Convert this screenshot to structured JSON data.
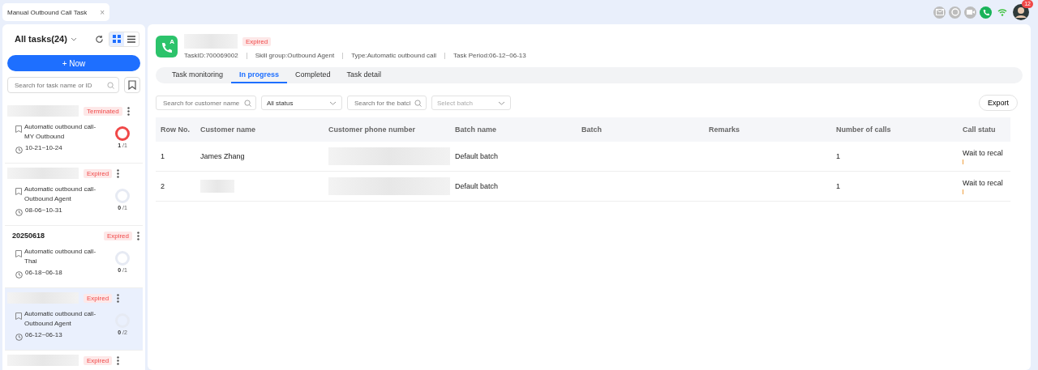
{
  "app_tab": {
    "title": "Manual Outbound Call Task",
    "close": "×"
  },
  "header_icons": [
    {
      "kind": "mail"
    },
    {
      "kind": "chat"
    },
    {
      "kind": "video"
    },
    {
      "kind": "phone"
    },
    {
      "kind": "wifi"
    },
    {
      "kind": "avatar",
      "badge": "12"
    }
  ],
  "sidebar": {
    "title": "All tasks(24)",
    "new_button": "+ Now",
    "search_placeholder": "Search for task name or ID",
    "tasks": [
      {
        "status": "Terminated",
        "type": "Automatic outbound call-MY Outbound",
        "period": "10-21~10-24",
        "count": "1",
        "total": "/1",
        "complete": true,
        "selected": false
      },
      {
        "status": "Expired",
        "type": "Automatic outbound call-Outbound Agent",
        "period": "08-06~10-31",
        "count": "0",
        "total": "/1",
        "complete": false,
        "selected": false
      },
      {
        "name": "20250618",
        "status": "Expired",
        "type": "Automatic outbound call-Thai",
        "period": "06-18~06-18",
        "count": "0",
        "total": "/1",
        "complete": false,
        "selected": false
      },
      {
        "status": "Expired",
        "type": "Automatic outbound call-Outbound Agent",
        "period": "06-12~06-13",
        "count": "0",
        "total": "/2",
        "complete": false,
        "selected": true
      },
      {
        "status": "Expired",
        "selected": false
      }
    ]
  },
  "task": {
    "logo_letter": "A",
    "status": "Expired",
    "meta": [
      "TaskID:700069002",
      "Skill group:Outbound Agent",
      "Type:Automatic outbound call",
      "Task Period:06-12~06-13"
    ]
  },
  "tabs": [
    {
      "label": "Task monitoring",
      "selected": false
    },
    {
      "label": "In progress",
      "selected": true
    },
    {
      "label": "Completed",
      "selected": false
    },
    {
      "label": "Task detail",
      "selected": false
    }
  ],
  "filters": [
    {
      "kind": "search",
      "placeholder": "Search for customer name"
    },
    {
      "kind": "select",
      "value": "All status"
    },
    {
      "kind": "search",
      "placeholder": "Search for the batcl"
    },
    {
      "kind": "select",
      "placeholder": "Select batch"
    }
  ],
  "export_button": "Export",
  "table": {
    "columns": [
      "Row No.",
      "Customer name",
      "Customer phone number",
      "Batch name",
      "Batch",
      "Remarks",
      "Number of calls",
      "Call statu"
    ],
    "rows": [
      {
        "row_no": "1",
        "customer_name": "James Zhang",
        "batch_name": "Default batch",
        "calls": "1",
        "call_status": "Wait to recal"
      },
      {
        "row_no": "2",
        "batch_name": "Default batch",
        "calls": "1",
        "call_status": "Wait to recal"
      }
    ]
  }
}
